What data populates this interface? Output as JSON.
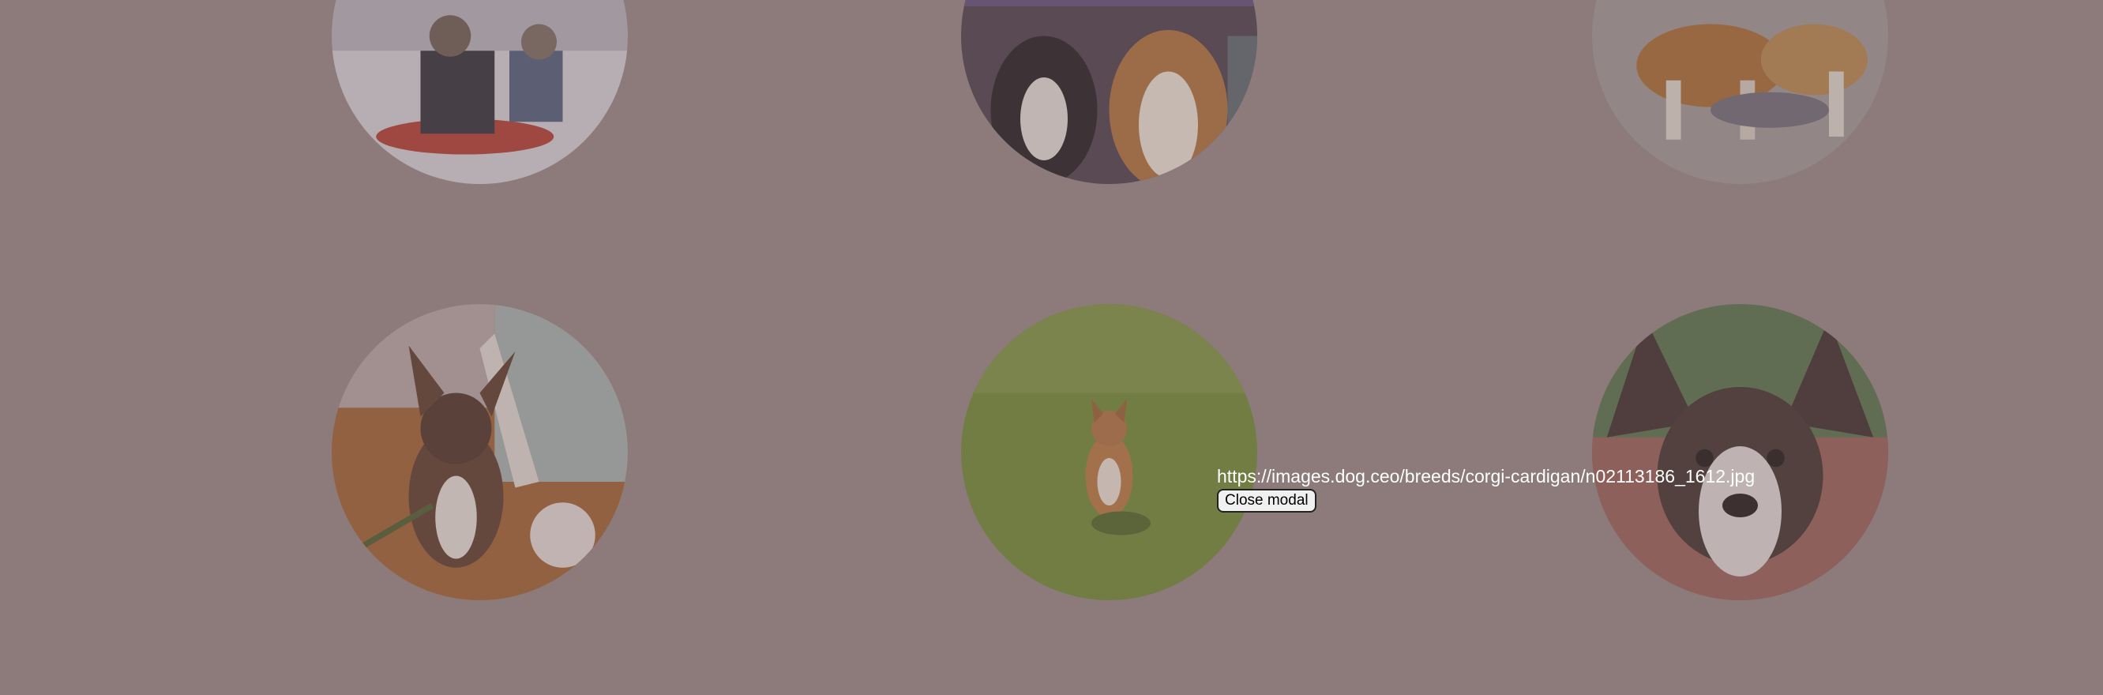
{
  "overlay": {
    "color": "#978786"
  },
  "gallery": {
    "images": [
      {
        "icon": "dog-sled-photo"
      },
      {
        "icon": "two-corgis-flowers-photo"
      },
      {
        "icon": "corgis-walking-photo"
      },
      {
        "icon": "brindle-corgi-hallway-photo"
      },
      {
        "icon": "corgi-on-grass-photo"
      },
      {
        "icon": "big-eared-corgi-photo"
      }
    ]
  },
  "modal": {
    "url": "https://images.dog.ceo/breeds/corgi-cardigan/n02113186_1612.jpg",
    "close_label": "Close modal"
  }
}
